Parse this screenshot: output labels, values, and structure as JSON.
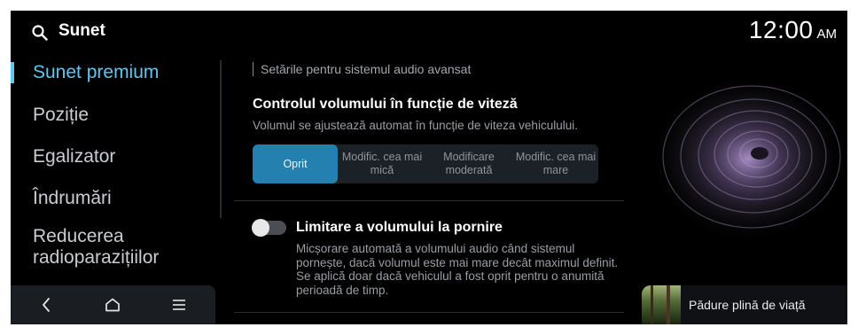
{
  "header": {
    "title": "Sunet",
    "time": "12:00",
    "ampm": "AM",
    "search_icon": "search-icon"
  },
  "sidebar": {
    "items": [
      {
        "label": "Sunet premium",
        "active": true
      },
      {
        "label": "Poziție"
      },
      {
        "label": "Egalizator"
      },
      {
        "label": "Îndrumări"
      },
      {
        "label": "Reducerea radioparazițiilor"
      }
    ]
  },
  "bottom_nav": {
    "icons": [
      "back-icon",
      "home-icon",
      "menu-icon"
    ]
  },
  "main": {
    "section_title": "Setările pentru sistemul audio avansat",
    "speed_volume": {
      "title": "Controlul volumului în funcție de viteză",
      "description": "Volumul se ajustează automat în funcție de viteza vehiculului.",
      "options": [
        "Oprit",
        "Modific. cea mai mică",
        "Modificare moderată",
        "Modific. cea mai mare"
      ],
      "selected": "Oprit"
    },
    "startup_limit": {
      "title": "Limitare a volumului la pornire",
      "description": "Micșorare automată a volumului audio când sistemul pornește, dacă volumul este mai mare decât maximul definit. Se aplică doar dacă vehiculul a fost oprit pentru o anumită perioadă de timp.",
      "enabled": false
    }
  },
  "now_playing": {
    "title": "Pădure plină de viață"
  },
  "colors": {
    "accent": "#5fc7ef",
    "selected_segment": "#2480ae",
    "background": "#000000"
  }
}
